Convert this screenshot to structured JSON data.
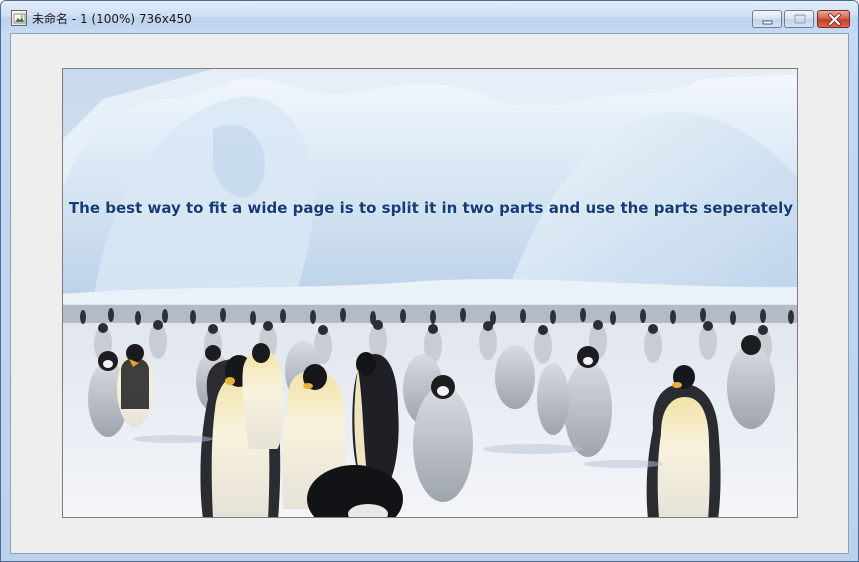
{
  "window": {
    "title": "未命名 - 1 (100%) 736x450",
    "controls": {
      "minimize": "minimize",
      "maximize": "maximize",
      "close": "close"
    }
  },
  "canvas": {
    "overlay_text": "The best way to fit a wide page is to split it in two parts and use the parts seperately",
    "image": "emperor-penguins-on-antarctic-ice"
  },
  "colors": {
    "overlay_text": "#123d78",
    "workspace": "#eeeeee",
    "titlebar": "#c6d9f0",
    "close_button": "#c33f26"
  },
  "icons": [
    "image-file-icon",
    "minimize-icon",
    "maximize-icon",
    "close-icon"
  ]
}
